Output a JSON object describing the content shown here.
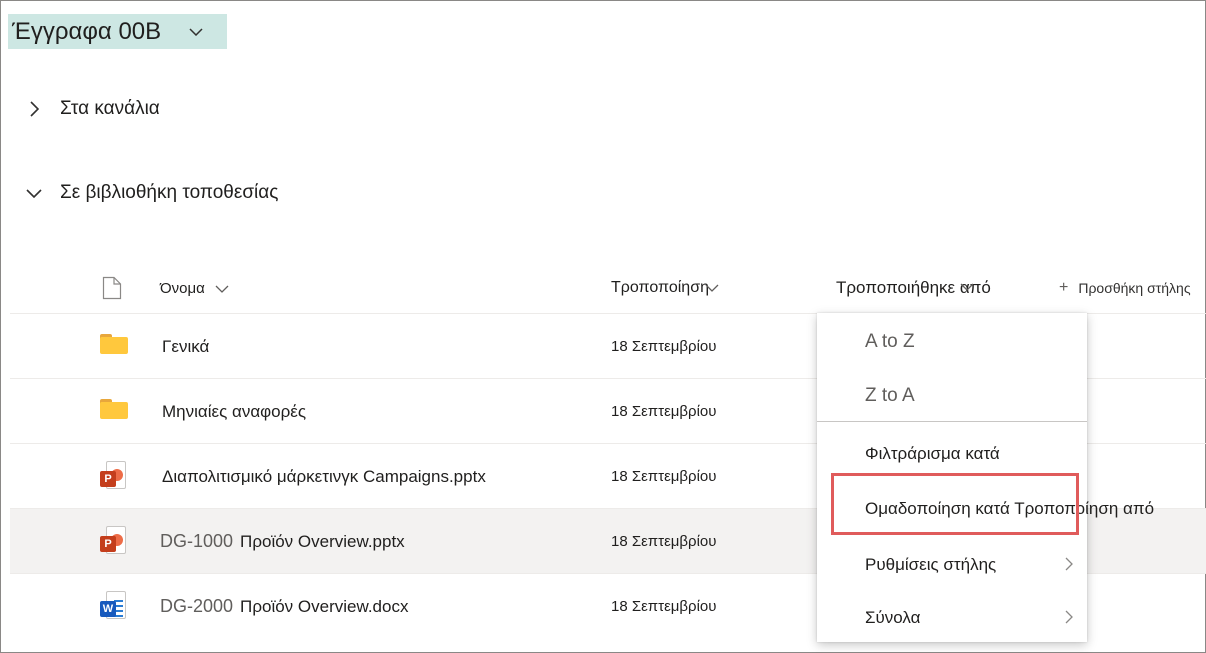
{
  "header": {
    "title": "Έγγραφα 00B"
  },
  "sections": {
    "channels": "Στα κανάλια",
    "library": "Σε βιβλιοθήκη τοποθεσίας"
  },
  "columns": {
    "name": "Όνομα",
    "modified": "Τροποποίηση",
    "modified_by": "Τροποποιήθηκε από",
    "add_column": "Προσθήκη στήλης"
  },
  "rows": [
    {
      "prefix": "",
      "name": "Γενικά",
      "date": "18 Σεπτεμβρίου",
      "icon": "folder-icon"
    },
    {
      "prefix": "",
      "name": "Μηνιαίες αναφορές",
      "date": "18 Σεπτεμβρίου",
      "icon": "folder-icon"
    },
    {
      "prefix": "",
      "name": "Διαπολιτισμικό μάρκετινγκ Campaigns.pptx",
      "date": "18 Σεπτεμβρίου",
      "icon": "powerpoint-icon"
    },
    {
      "prefix": "DG-1000",
      "name": "Προϊόν Overview.pptx",
      "date": "18 Σεπτεμβρίου",
      "icon": "powerpoint-icon"
    },
    {
      "prefix": "DG-2000",
      "name": "Προϊόν Overview.docx",
      "date": "18 Σεπτεμβρίου",
      "icon": "word-icon"
    }
  ],
  "menu": {
    "sort_az": "A to Z",
    "sort_za": "Z to A",
    "filter_by": "Φιλτράρισμα κατά",
    "group_by": "Ομαδοποίηση κατά Τροποποίηση από",
    "column_settings": "Ρυθμίσεις στήλης",
    "totals": "Σύνολα"
  },
  "colors": {
    "title_highlight": "#cde7e3",
    "focus_outline": "#e05b5b",
    "folder": "#ffc83d",
    "powerpoint": "#c43e1c",
    "word": "#185abd"
  }
}
